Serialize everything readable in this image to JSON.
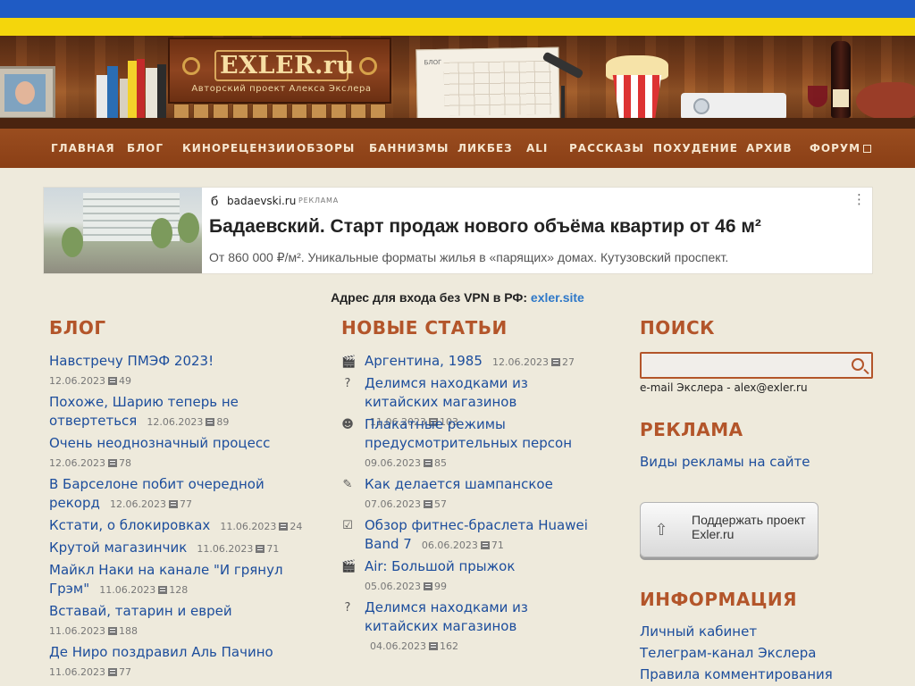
{
  "header": {
    "site_title": "EXLER.ru",
    "site_subtitle": "Авторский проект Алекса Экслера",
    "calendar_label": "БЛОГ",
    "blocks": [
      "",
      "",
      "",
      "",
      "",
      "",
      "",
      "",
      "",
      "",
      ""
    ]
  },
  "nav": {
    "items": [
      "ГЛАВНАЯ",
      "БЛОГ",
      "КИНОРЕЦЕНЗИИ",
      "ОБЗОРЫ",
      "БАННИЗМЫ",
      "ЛИКБЕЗ",
      "ALI",
      "РАССКАЗЫ",
      "ПОХУДЕНИЕ",
      "АРХИВ",
      "ФОРУМ"
    ]
  },
  "ad": {
    "favicon": "б",
    "domain": "badaevski.ru",
    "label": "РЕКЛАМА",
    "more": "⋮",
    "title": "Бадаевский. Старт продаж нового объёма квартир от 46 м²",
    "description": "От 860 000 ₽/м². Уникальные форматы жилья в «парящих» домах. Кутузовский проспект."
  },
  "vpn": {
    "text": "Адрес для входа без VPN в РФ:",
    "link": "exler.site"
  },
  "blog": {
    "title": "БЛОГ",
    "posts": [
      {
        "title": "Навстречу ПМЭФ 2023!",
        "date": "12.06.2023",
        "comments": "49"
      },
      {
        "title": "Похоже, Шарию теперь не отвертеться",
        "date": "12.06.2023",
        "comments": "89"
      },
      {
        "title": "Очень неоднозначный процесс",
        "date": "12.06.2023",
        "comments": "78"
      },
      {
        "title": "В Барселоне побит очередной рекорд",
        "date": "12.06.2023",
        "comments": "77"
      },
      {
        "title": "Кстати, о блокировках",
        "date": "11.06.2023",
        "comments": "24"
      },
      {
        "title": "Крутой магазинчик",
        "date": "11.06.2023",
        "comments": "71"
      },
      {
        "title": "Майкл Наки на канале \"И грянул Грэм\"",
        "date": "11.06.2023",
        "comments": "128"
      },
      {
        "title": "Вставай, татарин и еврей",
        "date": "11.06.2023",
        "comments": "188"
      },
      {
        "title": "Де Ниро поздравил Аль Пачино",
        "date": "11.06.2023",
        "comments": "77"
      }
    ]
  },
  "articles": {
    "title": "НОВЫЕ СТАТЬИ",
    "items": [
      {
        "icon": "film-icon",
        "glyph": "🎬",
        "title": "Аргентина, 1985",
        "date": "12.06.2023",
        "comments": "27"
      },
      {
        "icon": "question-icon",
        "glyph": "?",
        "title": "Делимся находками из китайских магазинов",
        "date": "11.06.2023",
        "comments": "103"
      },
      {
        "icon": "smiley-icon",
        "glyph": "☻",
        "title": "Плакатные режимы предусмотрительных персон",
        "date": "09.06.2023",
        "comments": "85"
      },
      {
        "icon": "pencil-icon",
        "glyph": "✎",
        "title": "Как делается шампанское",
        "date": "07.06.2023",
        "comments": "57"
      },
      {
        "icon": "clipboard-icon",
        "glyph": "☑",
        "title": "Обзор фитнес-браслета Huawei Band 7",
        "date": "06.06.2023",
        "comments": "71"
      },
      {
        "icon": "film-icon",
        "glyph": "🎬",
        "title": "Air: Большой прыжок",
        "date": "05.06.2023",
        "comments": "99"
      },
      {
        "icon": "question-icon",
        "glyph": "?",
        "title": "Делимся находками из китайских магазинов",
        "date": "04.06.2023",
        "comments": "162"
      }
    ]
  },
  "search": {
    "title": "ПОИСК",
    "placeholder": "",
    "email_line": "e-mail Экслера - alex@exler.ru"
  },
  "advertising": {
    "title": "РЕКЛАМА",
    "link": "Виды рекламы на сайте"
  },
  "support": {
    "label": "Поддержать проект Exler.ru"
  },
  "information": {
    "title": "ИНФОРМАЦИЯ",
    "links": [
      "Личный кабинет",
      "Телеграм-канал Экслера",
      "Правила комментирования"
    ]
  }
}
